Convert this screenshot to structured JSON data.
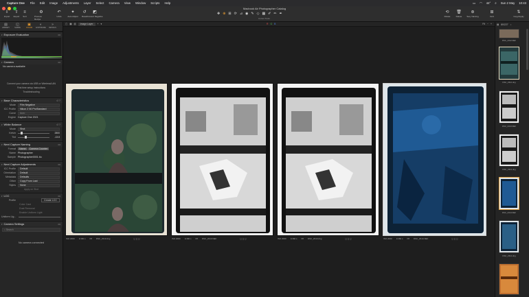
{
  "menubar": {
    "app": "Capture One",
    "items": [
      "File",
      "Edit",
      "Image",
      "Adjustments",
      "Layer",
      "Select",
      "Camera",
      "View",
      "Window",
      "Scripts",
      "Help"
    ],
    "status": [
      "44°",
      "Sun 2 May",
      "10:43"
    ]
  },
  "window_title": "Macbook Air Photographer Catalog",
  "toolbar": {
    "import": "Import",
    "export": "Export",
    "sort": "Sort",
    "process_recipe": "Process Recipe",
    "undo": "Undo",
    "auto_adjust": "Auto Adjust",
    "reset": "Reset",
    "convert_negative": "Convert Negative",
    "cursor_tools": "Cursor Tools",
    "rotate": "Rotate",
    "delete": "Delete",
    "seq_naming": "Seq. Naming",
    "grid": "Grid",
    "copy_apply": "Copy/Apply"
  },
  "tool_tabs": [
    "LIBRARY",
    "SHAPE",
    "COLOR",
    "EXPOSURE",
    "DETAILS"
  ],
  "sections": {
    "exposure": "Exposure Evaluation",
    "camera": "Camera",
    "base": "Base Characteristics",
    "white_balance": "White Balance",
    "next_naming": "Next Capture Naming",
    "next_adjust": "Next Capture Adjustments",
    "lcc": "LCC",
    "camera_settings": "Camera Settings"
  },
  "camera": {
    "none": "No camera available",
    "connect": "Connect your camera via USB or Wireless/LAN",
    "first_time": "First time setup instructions",
    "troubleshoot": "Troubleshooting"
  },
  "base": {
    "mode_label": "Mode",
    "mode": "Film Negative",
    "icc_label": "ICC Profile",
    "icc": "Nikon Z 50 ProStandard",
    "curve_label": "Curve",
    "curve": "Auto",
    "engine_label": "Engine",
    "engine": "Capture One 2021"
  },
  "white_balance": {
    "mode_label": "Mode",
    "mode": "Shot",
    "kelvin_label": "Kelvin",
    "kelvin": "2800",
    "tint_label": "Tint",
    "tint": "-13.8"
  },
  "naming": {
    "format_label": "Format",
    "format_a": "Name",
    "format_b": "Camera Counter",
    "name_label": "Name",
    "name": "Photographer",
    "sample_label": "Sample",
    "sample": "Photographer0001.tiu"
  },
  "next_adjust": {
    "icc_label": "ICC Profile",
    "icc": "Default",
    "orient_label": "Orientation",
    "orient": "Default",
    "meta_label": "Metadata",
    "meta": "Defaults",
    "other_label": "Other",
    "other": "Copy From Last",
    "styles_label": "Styles",
    "styles": "None",
    "apply": "Apply on Shot"
  },
  "lcc": {
    "profile_label": "Profile",
    "profile_btn": "Create LCC",
    "colorcast": "Color Cast",
    "dustremove": "Dust Removal",
    "uniform": "Enable Uniform Light",
    "uniform_light": "Uniform Lig..."
  },
  "camera_settings": {
    "search": "Search",
    "none": "No camera connected"
  },
  "viewer": {
    "layer": "Image Layer",
    "rgb": [
      "R",
      "G",
      "B"
    ]
  },
  "photos": [
    {
      "iso": "ISO 2000",
      "shutter": "1/160 s",
      "aperture": "f/8",
      "file": "DSC_2313.dng",
      "ev": "0"
    },
    {
      "iso": "ISO 2000",
      "shutter": "1/160 s",
      "aperture": "f/8",
      "file": "DSC_2313.NEF",
      "ev": "0"
    },
    {
      "iso": "ISO 2000",
      "shutter": "1/160 s",
      "aperture": "f/8",
      "file": "DSC_2313.dng",
      "ev": "0"
    },
    {
      "iso": "ISO 2000",
      "shutter": "1/160 s",
      "aperture": "f/8",
      "file": "DSC_2314.NEF",
      "ev": "0"
    }
  ],
  "browser": {
    "count": "80/227",
    "thumbs": [
      "DSC_2312.NEF",
      "DSC_2312.dng",
      "DSC_2313.NEF",
      "DSC_2313.dng",
      "DSC_2314.NEF",
      "DSC_2314.dng"
    ]
  },
  "colors": {
    "accent": "#f0a030",
    "panel": "#262626",
    "viewer": "#1e1e1e"
  }
}
